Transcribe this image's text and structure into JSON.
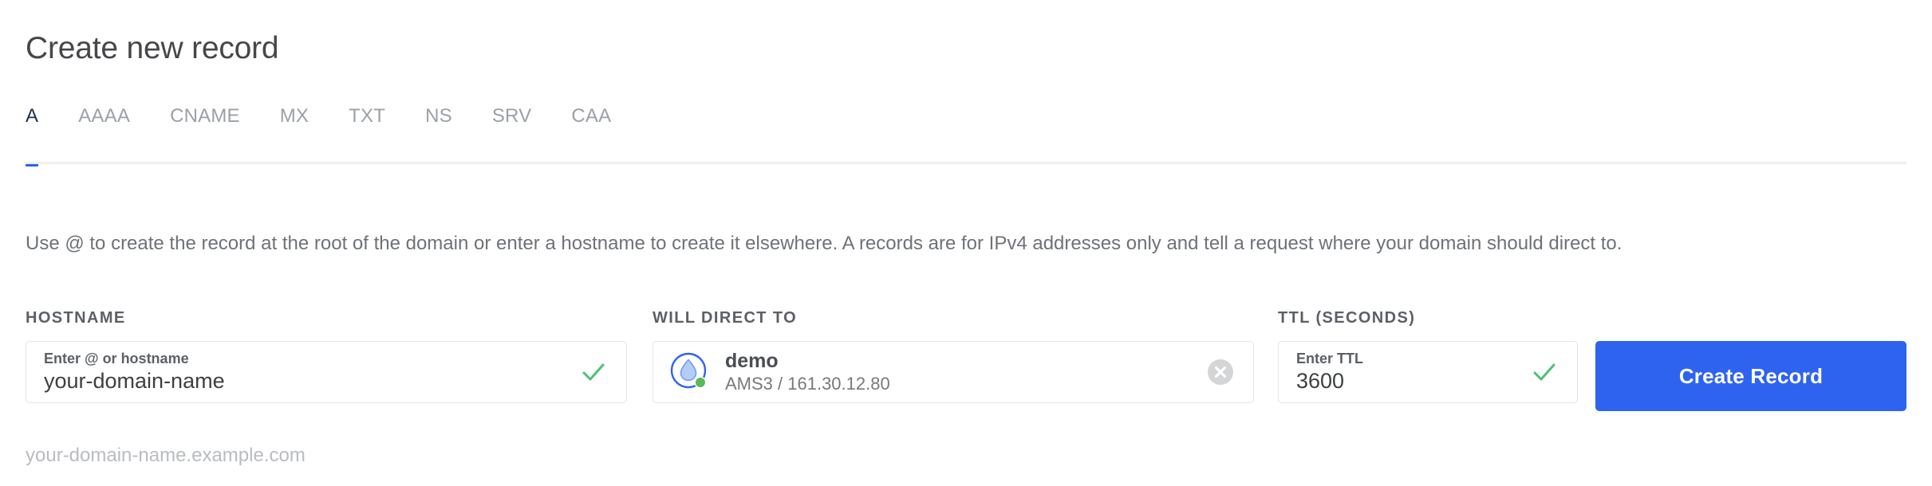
{
  "header": {
    "title": "Create new record"
  },
  "tabs": {
    "active": "A",
    "items": [
      {
        "label": "A",
        "active": true
      },
      {
        "label": "AAAA",
        "active": false
      },
      {
        "label": "CNAME",
        "active": false
      },
      {
        "label": "MX",
        "active": false
      },
      {
        "label": "TXT",
        "active": false
      },
      {
        "label": "NS",
        "active": false
      },
      {
        "label": "SRV",
        "active": false
      },
      {
        "label": "CAA",
        "active": false
      }
    ]
  },
  "description": "Use @ to create the record at the root of the domain or enter a hostname to create it elsewhere. A records are for IPv4 addresses only and tell a request where your domain should direct to.",
  "form": {
    "hostname": {
      "label": "HOSTNAME",
      "placeholder": "Enter @ or hostname",
      "value": "your-domain-name",
      "valid_icon": "check-icon"
    },
    "will_direct_to": {
      "label": "WILL DIRECT TO",
      "droplet_icon": "droplet-icon",
      "name": "demo",
      "meta": "AMS3 / 161.30.12.80",
      "clear_icon": "clear-circle-icon"
    },
    "ttl": {
      "label": "TTL (SECONDS)",
      "placeholder": "Enter TTL",
      "value": "3600",
      "valid_icon": "check-icon"
    },
    "submit_label": "Create Record"
  },
  "hint": "your-domain-name.example.com",
  "colors": {
    "accent_blue": "#2e63f0",
    "tab_active_text": "#20324f",
    "tab_inactive_text": "#9ba0a6",
    "check_green": "#4cc173",
    "droplet_blue": "#2e63f0",
    "droplet_fill": "#b4cdf7",
    "status_green": "#5cb85c",
    "clear_gray": "#d3d5d7",
    "hint_gray": "#b9bcc0",
    "body_text": "#6e7277"
  }
}
